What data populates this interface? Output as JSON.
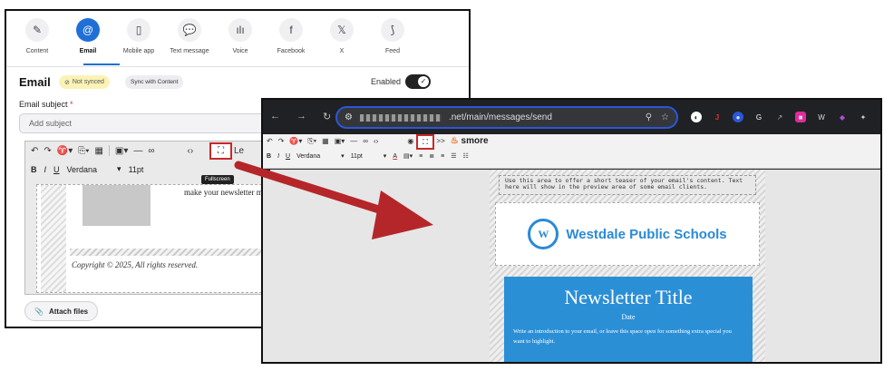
{
  "channels": [
    {
      "label": "Content",
      "icon": "✎"
    },
    {
      "label": "Email",
      "icon": "@"
    },
    {
      "label": "Mobile app",
      "icon": "▯"
    },
    {
      "label": "Text message",
      "icon": "💬"
    },
    {
      "label": "Voice",
      "icon": "ılı"
    },
    {
      "label": "Facebook",
      "icon": "f"
    },
    {
      "label": "X",
      "icon": "𝕏"
    },
    {
      "label": "Feed",
      "icon": "⟆"
    }
  ],
  "email_panel": {
    "title": "Email",
    "not_synced": "Not synced",
    "sync_button": "Sync with Content",
    "enabled_label": "Enabled",
    "subject_label": "Email subject",
    "subject_required": "*",
    "subject_placeholder": "Add subject",
    "toolbar": {
      "font": "Verdana",
      "size": "11pt",
      "less_label": "Le",
      "fullscreen_tooltip": "Fullscreen"
    },
    "editor_text": "make your newsletter mo",
    "copyright": "Copyright © 2025, All rights reserved.",
    "attach_label": "Attach files"
  },
  "browser": {
    "url_suffix": ".net/main/messages/send",
    "toolbar": {
      "less_label": "Less >>",
      "brand": "smore",
      "font": "Verdana",
      "size": "11pt"
    },
    "teaser": "Use this area to offer a short teaser of your email's content. Text here will show in the preview area of some email clients.",
    "school_name": "Westdale Public Schools",
    "crest_letter": "W",
    "hero_title": "Newsletter Title",
    "hero_date": "Date",
    "hero_intro": "Write an introduction to your email, or leave this space open for something extra special you want to highlight."
  },
  "colors": {
    "accent": "#1f6fd6",
    "highlight": "#c8282b",
    "school_blue": "#2a8ad6"
  }
}
